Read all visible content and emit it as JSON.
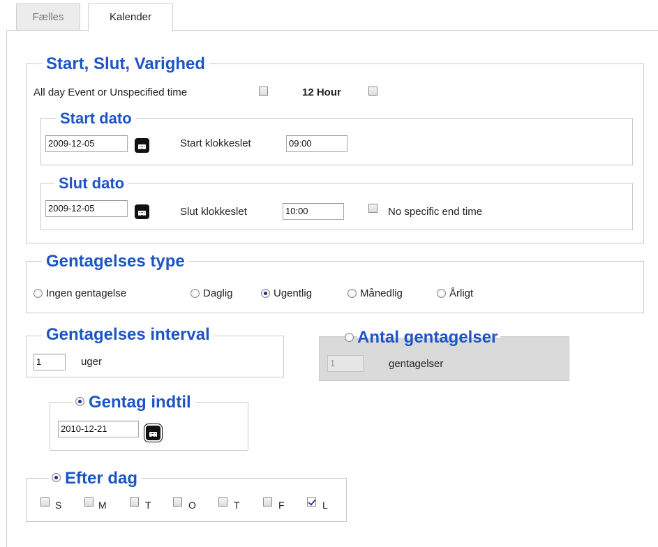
{
  "tabs": {
    "general": "Fælles",
    "calendar": "Kalender"
  },
  "timing": {
    "legend": "Start, Slut, Varighed",
    "all_day_label": "All day Event or Unspecified time",
    "twelve_hour_label": "12 Hour",
    "start": {
      "legend": "Start dato",
      "date_value": "2009-12-05",
      "time_label": "Start klokkeslet",
      "time_value": "09:00"
    },
    "end": {
      "legend": "Slut dato",
      "date_value": "2009-12-05",
      "time_label": "Slut klokkeslet",
      "time_value": "10:00",
      "no_end_label": "No specific end time"
    }
  },
  "repeat_type": {
    "legend": "Gentagelses type",
    "options": [
      {
        "label": "Ingen gentagelse",
        "checked": false
      },
      {
        "label": "Daglig",
        "checked": false
      },
      {
        "label": "Ugentlig",
        "checked": true
      },
      {
        "label": "Månedlig",
        "checked": false
      },
      {
        "label": "Årligt",
        "checked": false
      }
    ]
  },
  "interval": {
    "legend": "Gentagelses interval",
    "value": "1",
    "unit": "uger"
  },
  "count": {
    "legend": "Antal gentagelser",
    "value": "1",
    "unit": "gentagelser"
  },
  "until": {
    "legend": "Gentag indtil",
    "date_value": "2010-12-21"
  },
  "weekdays": {
    "legend": "Efter dag",
    "days": [
      {
        "label": "S",
        "checked": false
      },
      {
        "label": "M",
        "checked": false
      },
      {
        "label": "T",
        "checked": false
      },
      {
        "label": "O",
        "checked": false
      },
      {
        "label": "T",
        "checked": false
      },
      {
        "label": "F",
        "checked": false
      },
      {
        "label": "L",
        "checked": true
      }
    ]
  },
  "colors": {
    "legend": "#1d55c4",
    "border": "#c9c9c9",
    "disabled_bg": "#dadada"
  }
}
